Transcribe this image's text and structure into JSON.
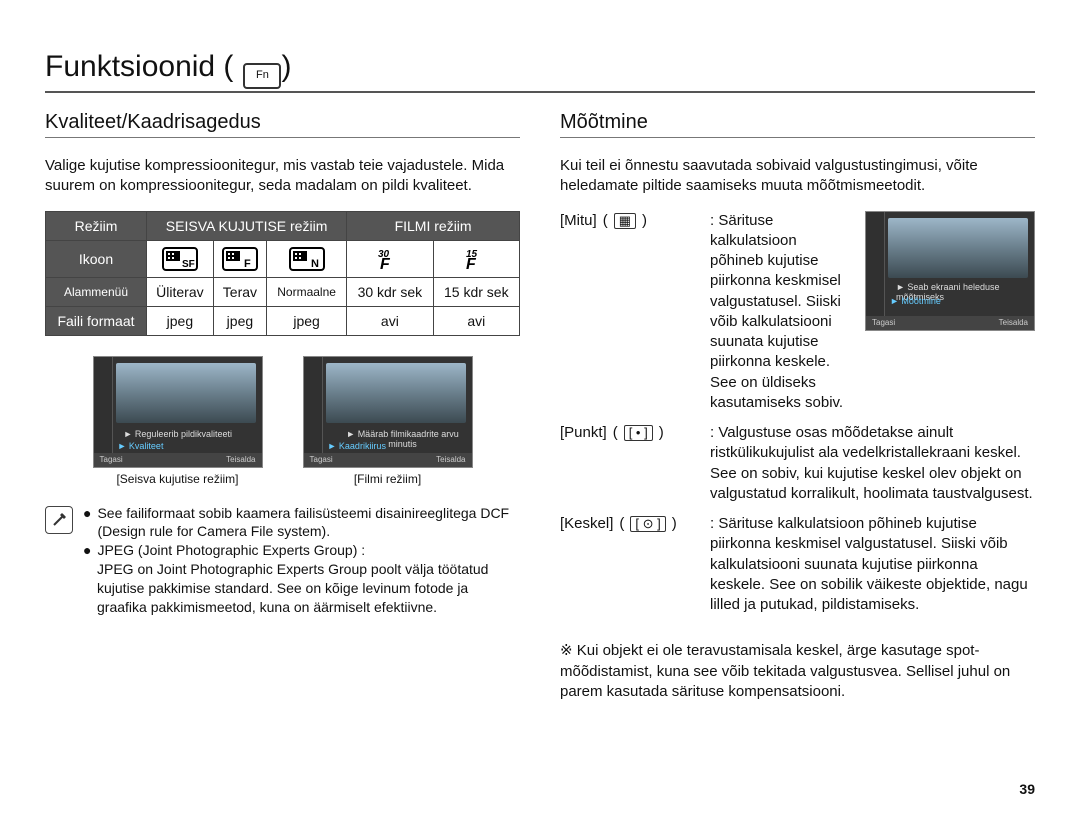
{
  "page": {
    "title": "Funktsioonid (",
    "title_close": ")",
    "number": "39"
  },
  "left": {
    "heading": "Kvaliteet/Kaadrisagedus",
    "intro": "Valige kujutise kompressioonitegur, mis vastab teie vajadustele. Mida suurem on kompressioonitegur, seda madalam on pildi kvaliteet.",
    "table": {
      "head": {
        "mode": "Režiim",
        "still": "SEISVA KUJUTISE režiim",
        "movie": "FILMI režiim"
      },
      "rows": {
        "icon": "Ikoon",
        "submenu": "Alammenüü",
        "file": "Faili formaat"
      },
      "sub": [
        "Üliterav",
        "Terav",
        "Normaalne",
        "30 kdr sek",
        "15 kdr sek"
      ],
      "fmt": [
        "jpeg",
        "jpeg",
        "jpeg",
        "avi",
        "avi"
      ]
    },
    "shots": [
      {
        "line1": "Reguleerib pildikvaliteeti",
        "hl": "Kvaliteet",
        "bl": "Tagasi",
        "br": "Teisalda",
        "cap": "[Seisva kujutise režiim]"
      },
      {
        "line1": "Määrab filmikaadrite arvu minutis",
        "hl": "Kaadrikiirus",
        "bl": "Tagasi",
        "br": "Teisalda",
        "cap": "[Filmi režiim]"
      }
    ],
    "notes": [
      "See failiformaat sobib kaamera failisüsteemi disainireeglitega DCF (Design rule for Camera File system).",
      "JPEG (Joint Photographic Experts Group) :",
      "JPEG on Joint Photographic Experts Group poolt välja töötatud kujutise pakkimise standard. See on kõige levinum fotode ja graafika pakkimismeetod, kuna on äärmiselt efektiivne."
    ]
  },
  "right": {
    "heading": "Mõõtmine",
    "intro": "Kui teil ei õnnestu saavutada sobivaid valgustustingimusi, võite heledamate piltide saamiseks muuta mõõtmismeetodit.",
    "shot": {
      "line1": "Seab ekraani heleduse mõõtmiseks",
      "hl": "Mõõtmine",
      "bl": "Tagasi",
      "br": "Teisalda"
    },
    "defs": [
      {
        "term": "[Mitu]",
        "sym": "▦",
        "body": "Särituse kalkulatsioon põhineb kujutise piirkonna keskmisel valgustatusel. Siiski võib kalkulatsiooni suunata kujutise piirkonna keskele. See on üldiseks kasutamiseks sobiv."
      },
      {
        "term": "[Punkt]",
        "sym": "[ • ]",
        "body": "Valgustuse osas mõõdetakse ainult ristkülikukujulist ala vedelkristallekraani keskel. See on sobiv, kui kujutise keskel olev objekt on valgustatud korralikult, hoolimata taustvalgusest."
      },
      {
        "term": "[Keskel]",
        "sym": "[ ⊙ ]",
        "body": "Särituse kalkulatsioon põhineb kujutise piirkonna keskmisel valgustatusel. Siiski võib kalkulatsiooni suunata kujutise piirkonna keskele. See on sobilik väikeste objektide, nagu lilled ja putukad, pildistamiseks."
      }
    ],
    "asterisk": "※ Kui objekt ei ole teravustamisala keskel, ärge kasutage spot-mõõdistamist, kuna see võib tekitada valgustusvea. Sellisel juhul on parem kasutada särituse kompensatsiooni."
  }
}
